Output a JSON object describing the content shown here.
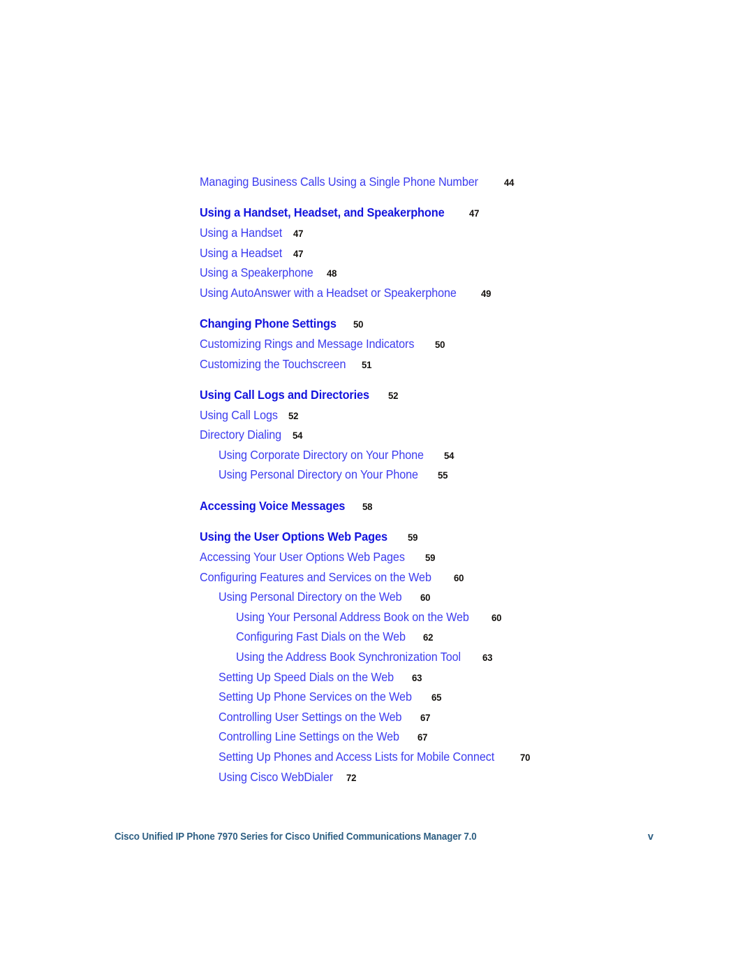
{
  "document": {
    "footer_text": "Cisco Unified IP Phone 7970 Series for Cisco Unified Communications Manager 7.0",
    "footer_page": "v"
  },
  "colors": {
    "entry_blue": "#3c3cef",
    "heading_blue": "#1414dd",
    "page_number": "#15120f",
    "footer_blue": "#2e5f83",
    "background": "#ffffff"
  },
  "toc": {
    "entries": [
      {
        "label": "Managing Business Calls Using a Single Phone Number",
        "page": "44",
        "level": 0,
        "style": "normal",
        "gap": false
      },
      {
        "label": "Using a Handset, Headset, and Speakerphone",
        "page": "47",
        "level": 0,
        "style": "heading",
        "gap": true
      },
      {
        "label": "Using a Handset",
        "page": "47",
        "level": 0,
        "style": "normal",
        "gap": false
      },
      {
        "label": "Using a Headset",
        "page": "47",
        "level": 0,
        "style": "normal",
        "gap": false
      },
      {
        "label": "Using a Speakerphone",
        "page": "48",
        "level": 0,
        "style": "normal",
        "gap": false
      },
      {
        "label": "Using AutoAnswer with a Headset or Speakerphone",
        "page": "49",
        "level": 0,
        "style": "normal",
        "gap": false
      },
      {
        "label": "Changing Phone Settings",
        "page": "50",
        "level": 0,
        "style": "heading",
        "gap": true
      },
      {
        "label": "Customizing Rings and Message Indicators",
        "page": "50",
        "level": 0,
        "style": "normal",
        "gap": false
      },
      {
        "label": "Customizing the Touchscreen",
        "page": "51",
        "level": 0,
        "style": "normal",
        "gap": false
      },
      {
        "label": "Using Call Logs and Directories",
        "page": "52",
        "level": 0,
        "style": "heading",
        "gap": true
      },
      {
        "label": "Using Call Logs",
        "page": "52",
        "level": 0,
        "style": "normal",
        "gap": false
      },
      {
        "label": "Directory Dialing",
        "page": "54",
        "level": 0,
        "style": "normal",
        "gap": false
      },
      {
        "label": "Using Corporate Directory on Your Phone",
        "page": "54",
        "level": 1,
        "style": "normal",
        "gap": false
      },
      {
        "label": "Using Personal Directory on Your Phone",
        "page": "55",
        "level": 1,
        "style": "normal",
        "gap": false
      },
      {
        "label": "Accessing Voice Messages",
        "page": "58",
        "level": 0,
        "style": "heading",
        "gap": true
      },
      {
        "label": "Using the User Options Web Pages",
        "page": "59",
        "level": 0,
        "style": "heading",
        "gap": true
      },
      {
        "label": "Accessing Your User Options Web Pages",
        "page": "59",
        "level": 0,
        "style": "normal",
        "gap": false
      },
      {
        "label": "Configuring Features and Services on the Web",
        "page": "60",
        "level": 0,
        "style": "normal",
        "gap": false
      },
      {
        "label": "Using Personal Directory on the Web",
        "page": "60",
        "level": 1,
        "style": "normal",
        "gap": false
      },
      {
        "label": "Using Your Personal Address Book on the Web",
        "page": "60",
        "level": 2,
        "style": "normal",
        "gap": false
      },
      {
        "label": "Configuring Fast Dials on the Web",
        "page": "62",
        "level": 2,
        "style": "normal",
        "gap": false
      },
      {
        "label": "Using the Address Book Synchronization Tool",
        "page": "63",
        "level": 2,
        "style": "normal",
        "gap": false
      },
      {
        "label": "Setting Up Speed Dials on the Web",
        "page": "63",
        "level": 1,
        "style": "normal",
        "gap": false
      },
      {
        "label": "Setting Up Phone Services on the Web",
        "page": "65",
        "level": 1,
        "style": "normal",
        "gap": false
      },
      {
        "label": "Controlling User Settings on the Web",
        "page": "67",
        "level": 1,
        "style": "normal",
        "gap": false
      },
      {
        "label": "Controlling Line Settings on the Web",
        "page": "67",
        "level": 1,
        "style": "normal",
        "gap": false
      },
      {
        "label": "Setting Up Phones and Access Lists for Mobile Connect",
        "page": "70",
        "level": 1,
        "style": "normal",
        "gap": false
      },
      {
        "label": "Using Cisco WebDialer",
        "page": "72",
        "level": 1,
        "style": "normal",
        "gap": false
      }
    ]
  }
}
